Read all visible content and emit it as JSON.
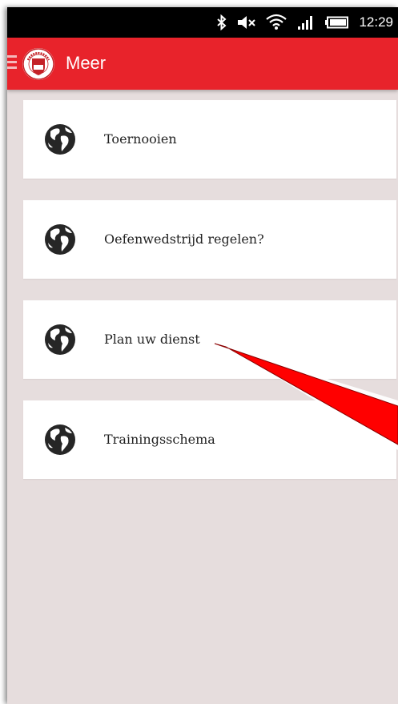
{
  "status_bar": {
    "time": "12:29",
    "icons": [
      "bluetooth-icon",
      "vibrate-mute-icon",
      "wifi-icon",
      "signal-icon",
      "battery-icon"
    ]
  },
  "app_bar": {
    "title": "Meer",
    "color": "#e8232b",
    "logo": "risalis-logo"
  },
  "menu": {
    "items": [
      {
        "label": "Toernooien",
        "icon": "globe-icon"
      },
      {
        "label": "Oefenwedstrijd regelen?",
        "icon": "globe-icon"
      },
      {
        "label": "Plan uw dienst",
        "icon": "globe-icon"
      },
      {
        "label": "Trainingsschema",
        "icon": "globe-icon"
      }
    ]
  },
  "annotation": {
    "arrow_color": "#ff0000",
    "points_to": "Plan uw dienst"
  },
  "colors": {
    "background": "#e6dddd",
    "card": "#ffffff"
  }
}
